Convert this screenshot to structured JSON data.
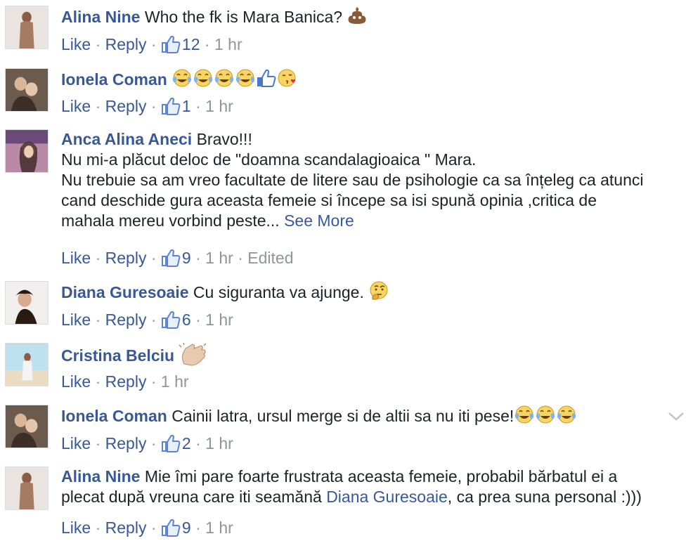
{
  "comments": [
    {
      "author": "Alina Nine",
      "text_lines": [
        "Who the fk is Mara Banica?"
      ],
      "emojis": [
        "poop-emoji"
      ],
      "actions": {
        "like": "Like",
        "reply": "Reply",
        "reactions": "12",
        "time": "1 hr",
        "edited": ""
      }
    },
    {
      "author": "Ionela Coman",
      "text_lines": [
        ""
      ],
      "emojis": [
        "tears-of-joy-emoji",
        "tears-of-joy-emoji",
        "tears-of-joy-emoji",
        "tears-of-joy-emoji",
        "thumbs-up-emoji",
        "kiss-emoji"
      ],
      "actions": {
        "like": "Like",
        "reply": "Reply",
        "reactions": "1",
        "time": "1 hr",
        "edited": ""
      }
    },
    {
      "author": "Anca Alina Aneci",
      "text_lines": [
        "Bravo!!!",
        "Nu mi-a plăcut deloc de \"doamna scandalagioaica \" Mara.",
        "Nu trebuie sa am vreo facultate de litere sau de psihologie ca sa înțeleg ca atunci",
        "cand deschide gura aceasta femeie si începe sa isi spună opinia ,critica de",
        "mahala mereu vorbind peste..."
      ],
      "see_more": "See More",
      "actions": {
        "like": "Like",
        "reply": "Reply",
        "reactions": "9",
        "time": "1 hr",
        "edited": "Edited"
      }
    },
    {
      "author": "Diana Guresoaie",
      "text_lines": [
        "Cu siguranta va ajunge."
      ],
      "emojis": [
        "thinking-face-emoji"
      ],
      "actions": {
        "like": "Like",
        "reply": "Reply",
        "reactions": "6",
        "time": "1 hr",
        "edited": ""
      }
    },
    {
      "author": "Cristina Belciu",
      "text_lines": [
        ""
      ],
      "emojis": [
        "clapping-hands-emoji"
      ],
      "actions": {
        "like": "Like",
        "reply": "Reply",
        "reactions": "",
        "time": "1 hr",
        "edited": ""
      }
    },
    {
      "author": "Ionela Coman",
      "text_lines": [
        "Cainii latra, ursul merge si de altii sa nu iti pese!"
      ],
      "emojis": [
        "tears-of-joy-emoji",
        "tears-of-joy-emoji",
        "tears-of-joy-emoji"
      ],
      "actions": {
        "like": "Like",
        "reply": "Reply",
        "reactions": "2",
        "time": "1 hr",
        "edited": ""
      }
    },
    {
      "author": "Alina Nine",
      "text_lines": [
        "Mie îmi pare foarte frustrata aceasta femeie, probabil bărbatul ei a",
        "plecat după vreuna care iti seamănă",
        ", ca prea suna personal :)))"
      ],
      "mention": "Diana Guresoaie",
      "actions": {
        "like": "Like",
        "reply": "Reply",
        "reactions": "9",
        "time": "1 hr",
        "edited": ""
      }
    }
  ],
  "separator": "·",
  "colors": {
    "link": "#385898",
    "meta": "#90949c",
    "text": "#1d2129",
    "like_blue": "#5890ff"
  }
}
